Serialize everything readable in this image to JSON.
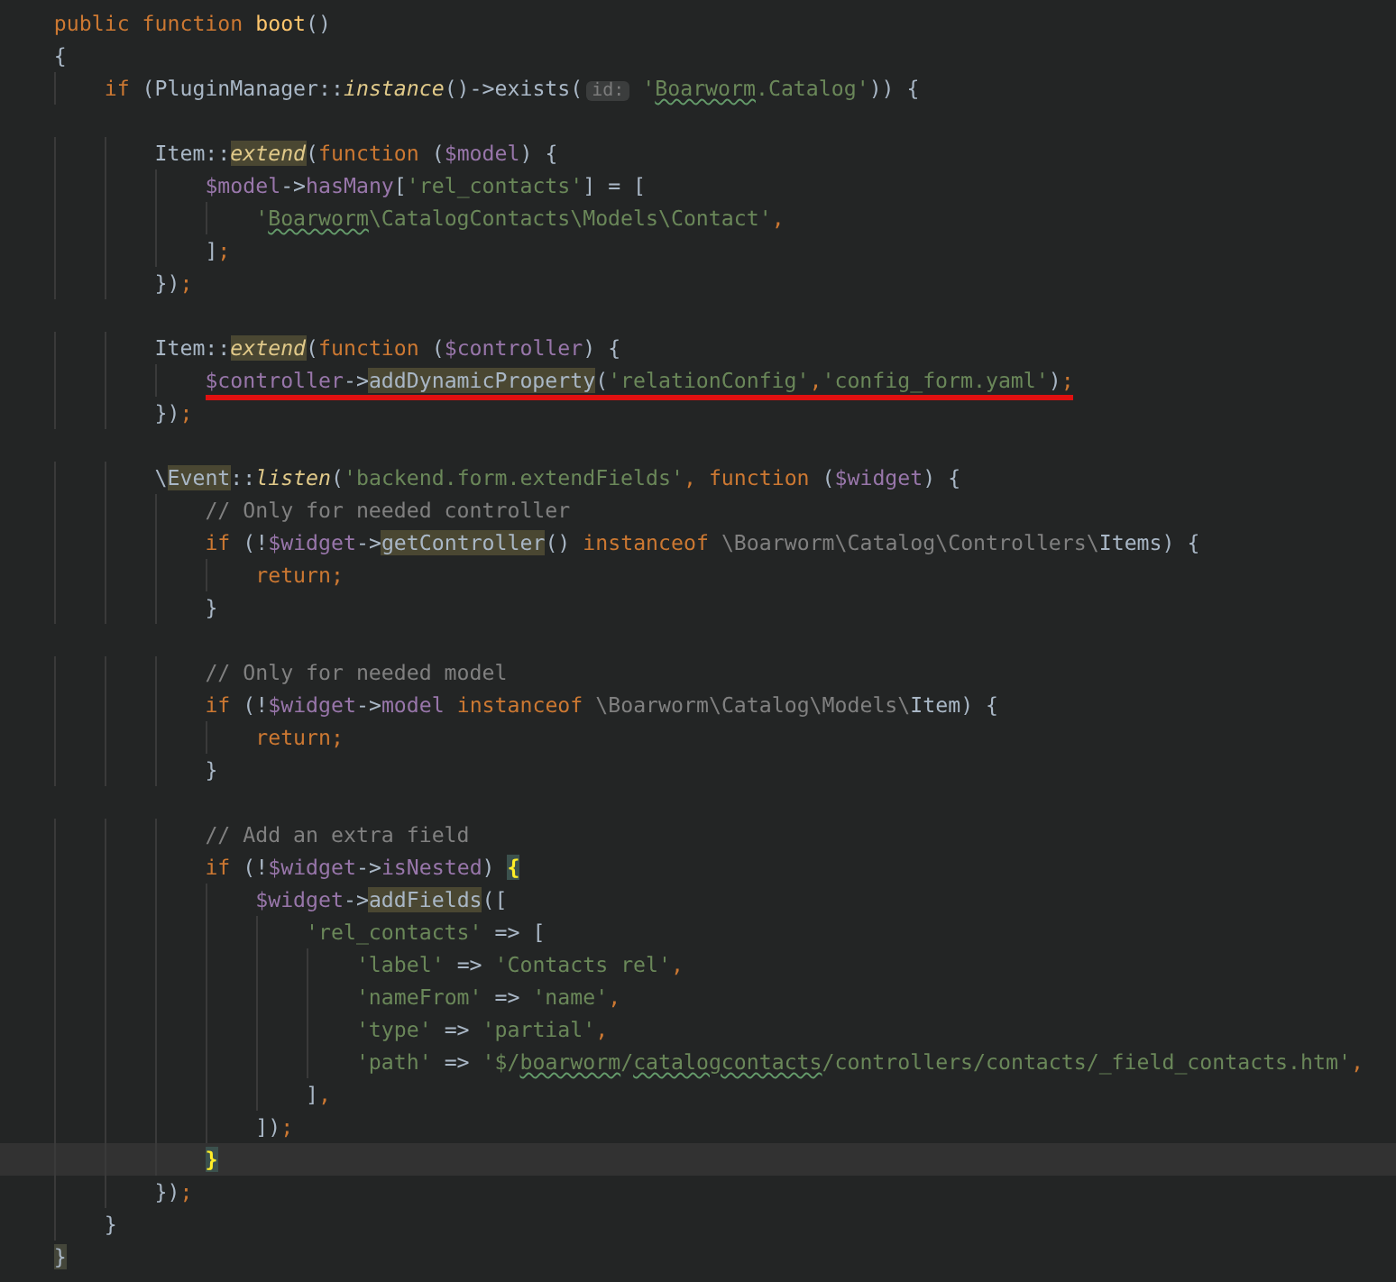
{
  "editor": {
    "lines": [
      {
        "marked": false,
        "current": false,
        "tokens": [
          {
            "text": "    public function ",
            "kind": "keyword"
          },
          {
            "text": "boot",
            "kind": "function"
          },
          {
            "text": "()",
            "kind": "plain"
          }
        ]
      },
      {
        "marked": false,
        "current": false,
        "tokens": [
          {
            "text": "    {",
            "kind": "plain"
          }
        ]
      },
      {
        "marked": false,
        "current": false,
        "tokens": [
          {
            "text": "        if",
            "kind": "keyword"
          },
          {
            "text": " (PluginManager::",
            "kind": "plain"
          },
          {
            "text": "instance",
            "kind": "static"
          },
          {
            "text": "()->exists(",
            "kind": "plain"
          },
          {
            "text": "id:",
            "kind": "hint"
          },
          {
            "text": " '",
            "kind": "string"
          },
          {
            "text": "Boarworm",
            "kind": "string-typo"
          },
          {
            "text": ".Catalog'",
            "kind": "string"
          },
          {
            "text": ")) {",
            "kind": "plain"
          }
        ]
      },
      {
        "marked": false,
        "current": false
      },
      {
        "marked": false,
        "current": false,
        "tokens": [
          {
            "text": "            Item::",
            "kind": "plain"
          },
          {
            "text": "extend",
            "kind": "static-usage"
          },
          {
            "text": "(",
            "kind": "plain"
          },
          {
            "text": "function",
            "kind": "keyword"
          },
          {
            "text": " (",
            "kind": "plain"
          },
          {
            "text": "$model",
            "kind": "variable"
          },
          {
            "text": ") {",
            "kind": "plain"
          }
        ]
      },
      {
        "marked": false,
        "current": false,
        "tokens": [
          {
            "text": "                $model",
            "kind": "variable"
          },
          {
            "text": "->",
            "kind": "plain"
          },
          {
            "text": "hasMany",
            "kind": "property"
          },
          {
            "text": "[",
            "kind": "plain"
          },
          {
            "text": "'rel_contacts'",
            "kind": "string"
          },
          {
            "text": "] = [",
            "kind": "plain"
          }
        ]
      },
      {
        "marked": false,
        "current": false,
        "tokens": [
          {
            "text": "                    '",
            "kind": "string"
          },
          {
            "text": "Boarworm",
            "kind": "string-typo"
          },
          {
            "text": "\\CatalogContacts\\Models\\Contact'",
            "kind": "string"
          },
          {
            "text": ",",
            "kind": "punct"
          }
        ]
      },
      {
        "marked": false,
        "current": false,
        "tokens": [
          {
            "text": "                ]",
            "kind": "plain"
          },
          {
            "text": ";",
            "kind": "punct"
          }
        ]
      },
      {
        "marked": false,
        "current": false,
        "tokens": [
          {
            "text": "            })",
            "kind": "plain"
          },
          {
            "text": ";",
            "kind": "punct"
          }
        ]
      },
      {
        "marked": false,
        "current": false
      },
      {
        "marked": false,
        "current": false,
        "tokens": [
          {
            "text": "            Item::",
            "kind": "plain"
          },
          {
            "text": "extend",
            "kind": "static-usage"
          },
          {
            "text": "(",
            "kind": "plain"
          },
          {
            "text": "function",
            "kind": "keyword"
          },
          {
            "text": " (",
            "kind": "plain"
          },
          {
            "text": "$controller",
            "kind": "variable"
          },
          {
            "text": ") {",
            "kind": "plain"
          }
        ]
      },
      {
        "marked": true,
        "current": false,
        "tokens": [
          {
            "text": "                $controller",
            "kind": "variable"
          },
          {
            "text": "->",
            "kind": "plain"
          },
          {
            "text": "addDynamicProperty",
            "kind": "method-usage"
          },
          {
            "text": "(",
            "kind": "plain"
          },
          {
            "text": "'relationConfig'",
            "kind": "string"
          },
          {
            "text": ",",
            "kind": "punct"
          },
          {
            "text": "'config_form.yaml'",
            "kind": "string"
          },
          {
            "text": ")",
            "kind": "plain"
          },
          {
            "text": ";",
            "kind": "punct"
          }
        ]
      },
      {
        "marked": false,
        "current": false,
        "tokens": [
          {
            "text": "            })",
            "kind": "plain"
          },
          {
            "text": ";",
            "kind": "punct"
          }
        ]
      },
      {
        "marked": false,
        "current": false
      },
      {
        "marked": false,
        "current": false,
        "tokens": [
          {
            "text": "            \\",
            "kind": "plain"
          },
          {
            "text": "Event",
            "kind": "class-usage"
          },
          {
            "text": "::",
            "kind": "plain"
          },
          {
            "text": "listen",
            "kind": "static"
          },
          {
            "text": "(",
            "kind": "plain"
          },
          {
            "text": "'backend.form.extendFields'",
            "kind": "string"
          },
          {
            "text": ",",
            "kind": "punct"
          },
          {
            "text": " function",
            "kind": "keyword"
          },
          {
            "text": " (",
            "kind": "plain"
          },
          {
            "text": "$widget",
            "kind": "variable"
          },
          {
            "text": ") {",
            "kind": "plain"
          }
        ]
      },
      {
        "marked": false,
        "current": false,
        "tokens": [
          {
            "text": "                // Only for needed controller",
            "kind": "comment"
          }
        ]
      },
      {
        "marked": false,
        "current": false,
        "tokens": [
          {
            "text": "                if",
            "kind": "keyword"
          },
          {
            "text": " (!",
            "kind": "plain"
          },
          {
            "text": "$widget",
            "kind": "variable"
          },
          {
            "text": "->",
            "kind": "plain"
          },
          {
            "text": "getController",
            "kind": "method-usage"
          },
          {
            "text": "() ",
            "kind": "plain"
          },
          {
            "text": "instanceof",
            "kind": "keyword"
          },
          {
            "text": " \\Boarworm\\Catalog\\Controllers\\",
            "kind": "namespace"
          },
          {
            "text": "Items) {",
            "kind": "plain"
          }
        ]
      },
      {
        "marked": false,
        "current": false,
        "tokens": [
          {
            "text": "                    return",
            "kind": "keyword"
          },
          {
            "text": ";",
            "kind": "punct"
          }
        ]
      },
      {
        "marked": false,
        "current": false,
        "tokens": [
          {
            "text": "                }",
            "kind": "plain"
          }
        ]
      },
      {
        "marked": false,
        "current": false
      },
      {
        "marked": false,
        "current": false,
        "tokens": [
          {
            "text": "                // Only for needed model",
            "kind": "comment"
          }
        ]
      },
      {
        "marked": false,
        "current": false,
        "tokens": [
          {
            "text": "                if",
            "kind": "keyword"
          },
          {
            "text": " (!",
            "kind": "plain"
          },
          {
            "text": "$widget",
            "kind": "variable"
          },
          {
            "text": "->",
            "kind": "plain"
          },
          {
            "text": "model",
            "kind": "property"
          },
          {
            "text": " instanceof",
            "kind": "keyword"
          },
          {
            "text": " \\Boarworm\\Catalog\\Models\\",
            "kind": "namespace"
          },
          {
            "text": "Item) {",
            "kind": "plain"
          }
        ]
      },
      {
        "marked": false,
        "current": false,
        "tokens": [
          {
            "text": "                    return",
            "kind": "keyword"
          },
          {
            "text": ";",
            "kind": "punct"
          }
        ]
      },
      {
        "marked": false,
        "current": false,
        "tokens": [
          {
            "text": "                }",
            "kind": "plain"
          }
        ]
      },
      {
        "marked": false,
        "current": false
      },
      {
        "marked": false,
        "current": false,
        "tokens": [
          {
            "text": "                // Add an extra field",
            "kind": "comment"
          }
        ]
      },
      {
        "marked": false,
        "current": false,
        "tokens": [
          {
            "text": "                if",
            "kind": "keyword"
          },
          {
            "text": " (!",
            "kind": "plain"
          },
          {
            "text": "$widget",
            "kind": "variable"
          },
          {
            "text": "->",
            "kind": "plain"
          },
          {
            "text": "isNested",
            "kind": "property"
          },
          {
            "text": ") ",
            "kind": "plain"
          },
          {
            "text": "{",
            "kind": "brace-match"
          }
        ]
      },
      {
        "marked": false,
        "current": false,
        "tokens": [
          {
            "text": "                    $widget",
            "kind": "variable"
          },
          {
            "text": "->",
            "kind": "plain"
          },
          {
            "text": "addFields",
            "kind": "method-usage"
          },
          {
            "text": "([",
            "kind": "plain"
          }
        ]
      },
      {
        "marked": false,
        "current": false,
        "tokens": [
          {
            "text": "                        'rel_contacts'",
            "kind": "string"
          },
          {
            "text": " => [",
            "kind": "plain"
          }
        ]
      },
      {
        "marked": false,
        "current": false,
        "tokens": [
          {
            "text": "                            'label'",
            "kind": "string"
          },
          {
            "text": " => ",
            "kind": "plain"
          },
          {
            "text": "'Contacts rel'",
            "kind": "string"
          },
          {
            "text": ",",
            "kind": "punct"
          }
        ]
      },
      {
        "marked": false,
        "current": false,
        "tokens": [
          {
            "text": "                            'nameFrom'",
            "kind": "string"
          },
          {
            "text": " => ",
            "kind": "plain"
          },
          {
            "text": "'name'",
            "kind": "string"
          },
          {
            "text": ",",
            "kind": "punct"
          }
        ]
      },
      {
        "marked": false,
        "current": false,
        "tokens": [
          {
            "text": "                            'type'",
            "kind": "string"
          },
          {
            "text": " => ",
            "kind": "plain"
          },
          {
            "text": "'partial'",
            "kind": "string"
          },
          {
            "text": ",",
            "kind": "punct"
          }
        ]
      },
      {
        "marked": false,
        "current": false,
        "tokens": [
          {
            "text": "                            'path'",
            "kind": "string"
          },
          {
            "text": " => ",
            "kind": "plain"
          },
          {
            "text": "'$/",
            "kind": "string"
          },
          {
            "text": "boarworm",
            "kind": "string-typo"
          },
          {
            "text": "/",
            "kind": "string"
          },
          {
            "text": "catalogcontacts",
            "kind": "string-typo"
          },
          {
            "text": "/controllers/contacts/_field_contacts.htm'",
            "kind": "string"
          },
          {
            "text": ",",
            "kind": "punct"
          }
        ]
      },
      {
        "marked": false,
        "current": false,
        "tokens": [
          {
            "text": "                        ]",
            "kind": "plain"
          },
          {
            "text": ",",
            "kind": "punct"
          }
        ]
      },
      {
        "marked": false,
        "current": false,
        "tokens": [
          {
            "text": "                    ])",
            "kind": "plain"
          },
          {
            "text": ";",
            "kind": "punct"
          }
        ]
      },
      {
        "marked": false,
        "current": true,
        "tokens": [
          {
            "text": "                }",
            "kind": "brace-match"
          }
        ]
      },
      {
        "marked": false,
        "current": false,
        "tokens": [
          {
            "text": "            })",
            "kind": "plain"
          },
          {
            "text": ";",
            "kind": "punct"
          }
        ]
      },
      {
        "marked": false,
        "current": false,
        "tokens": [
          {
            "text": "        }",
            "kind": "plain"
          }
        ]
      },
      {
        "marked": false,
        "current": false,
        "tokens": [
          {
            "text": "    }",
            "kind": "brace-pair"
          }
        ]
      }
    ]
  }
}
